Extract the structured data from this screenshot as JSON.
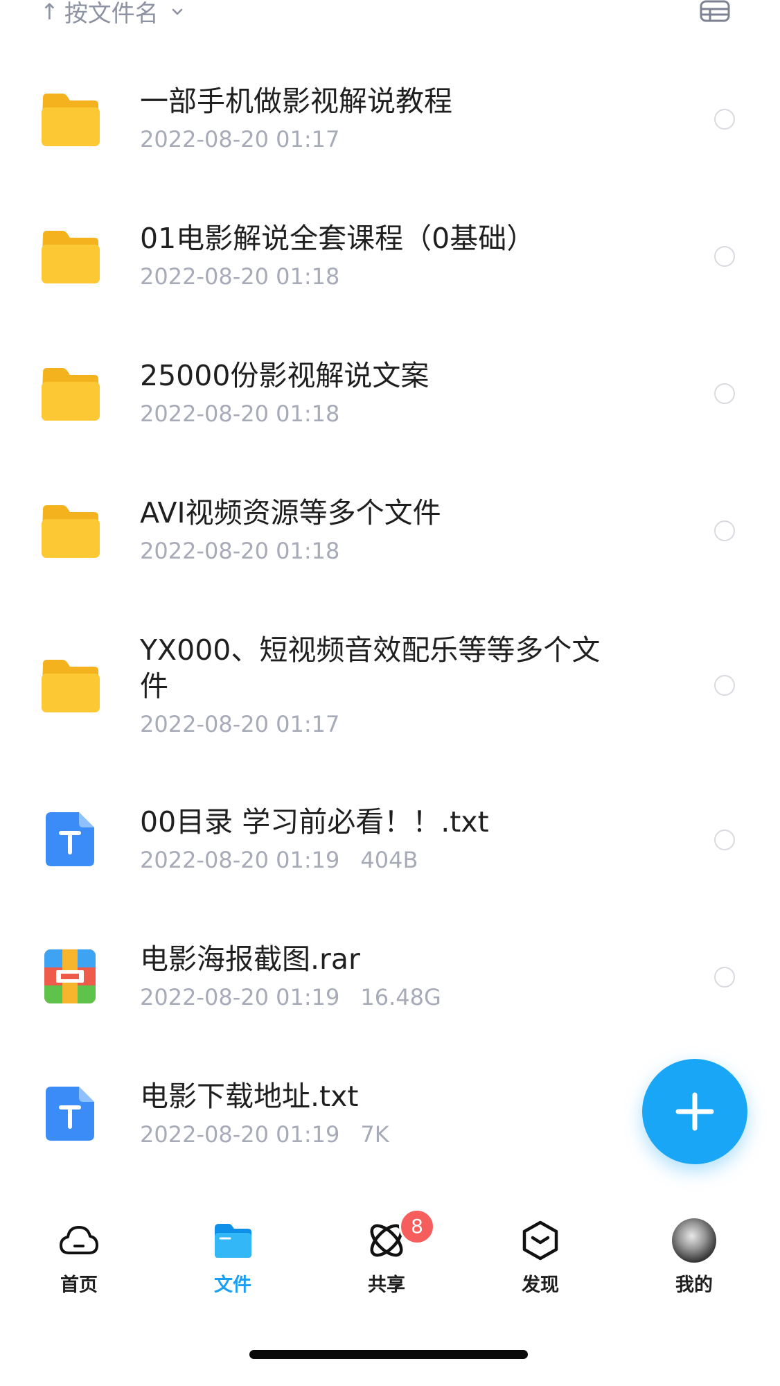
{
  "sort": {
    "label": "按文件名"
  },
  "files": [
    {
      "type": "folder",
      "name": "一部手机做影视解说教程",
      "date": "2022-08-20 01:17",
      "size": ""
    },
    {
      "type": "folder",
      "name": "01电影解说全套课程（0基础）",
      "date": "2022-08-20 01:18",
      "size": ""
    },
    {
      "type": "folder",
      "name": "25000份影视解说文案",
      "date": "2022-08-20 01:18",
      "size": ""
    },
    {
      "type": "folder",
      "name": "AVI视频资源等多个文件",
      "date": "2022-08-20 01:18",
      "size": ""
    },
    {
      "type": "folder",
      "name": "YX000、短视频音效配乐等等多个文件",
      "date": "2022-08-20 01:17",
      "size": ""
    },
    {
      "type": "txt",
      "name": "00目录 学习前必看！！.txt",
      "date": "2022-08-20 01:19",
      "size": "404B"
    },
    {
      "type": "rar",
      "name": "电影海报截图.rar",
      "date": "2022-08-20 01:19",
      "size": "16.48G"
    },
    {
      "type": "txt",
      "name": "电影下载地址.txt",
      "date": "2022-08-20 01:19",
      "size": "7K"
    }
  ],
  "tabs": [
    {
      "label": "首页",
      "icon": "cloud-icon"
    },
    {
      "label": "文件",
      "icon": "folder-icon"
    },
    {
      "label": "共享",
      "icon": "atom-icon",
      "badge": "8"
    },
    {
      "label": "发现",
      "icon": "cube-icon"
    },
    {
      "label": "我的",
      "icon": "avatar"
    }
  ],
  "colors": {
    "accent": "#1a9ff2",
    "fab": "#19a6f7",
    "folder": "#fcc934",
    "badge": "#f65d5d"
  }
}
